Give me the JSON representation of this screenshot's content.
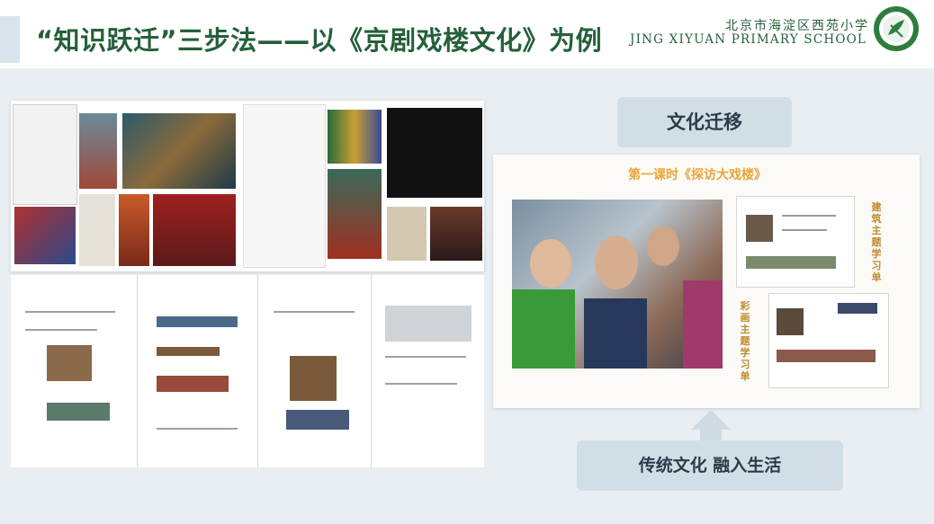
{
  "header": {
    "title": "“知识跃迁”三步法——以《京剧戏楼文化》为例",
    "school_name_cn": "北京市海淀区西苑小学",
    "school_name_en": "JING XIYUAN PRIMARY SCHOOL",
    "logo_icon": "school-emblem-icon"
  },
  "tags": {
    "top": "文化迁移",
    "bottom": "传统文化 融入生活"
  },
  "lesson_card": {
    "title": "第一课时《探访大戏楼》",
    "worksheet_labels": [
      "建筑主题学习单",
      "彩画主题学习单"
    ]
  },
  "colors": {
    "title_green": "#25603a",
    "tag_bg": "#d2dee6",
    "lesson_title_orange": "#e8a63a"
  }
}
